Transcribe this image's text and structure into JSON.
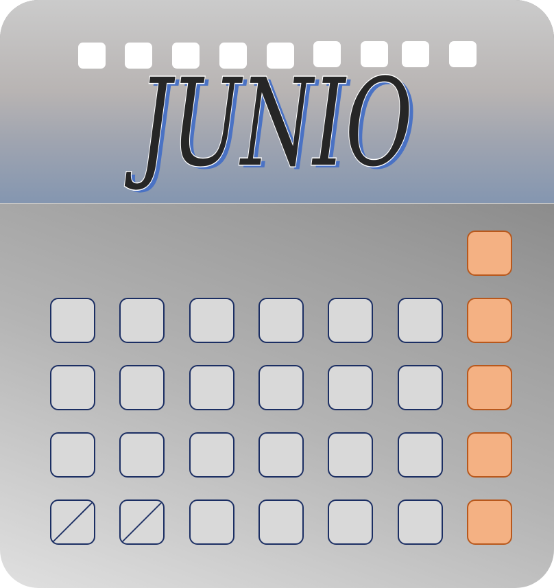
{
  "calendar": {
    "month": "JUNIO",
    "icon": "calendar-icon",
    "colors": {
      "header_top": "#cbcbcb",
      "header_bottom": "#8496b0",
      "month_text": "#262626",
      "month_shadow": "#4a72c4",
      "day_cell": "#d9d9d9",
      "day_border": "#1b2e63",
      "weekend_cell": "#f4b183",
      "weekend_border": "#b8581c"
    },
    "grid": {
      "rows": 5,
      "columns": 7,
      "first_row_filled_columns": [
        7
      ],
      "crossed_out_cells": [
        [
          5,
          1
        ],
        [
          5,
          2
        ]
      ]
    }
  }
}
